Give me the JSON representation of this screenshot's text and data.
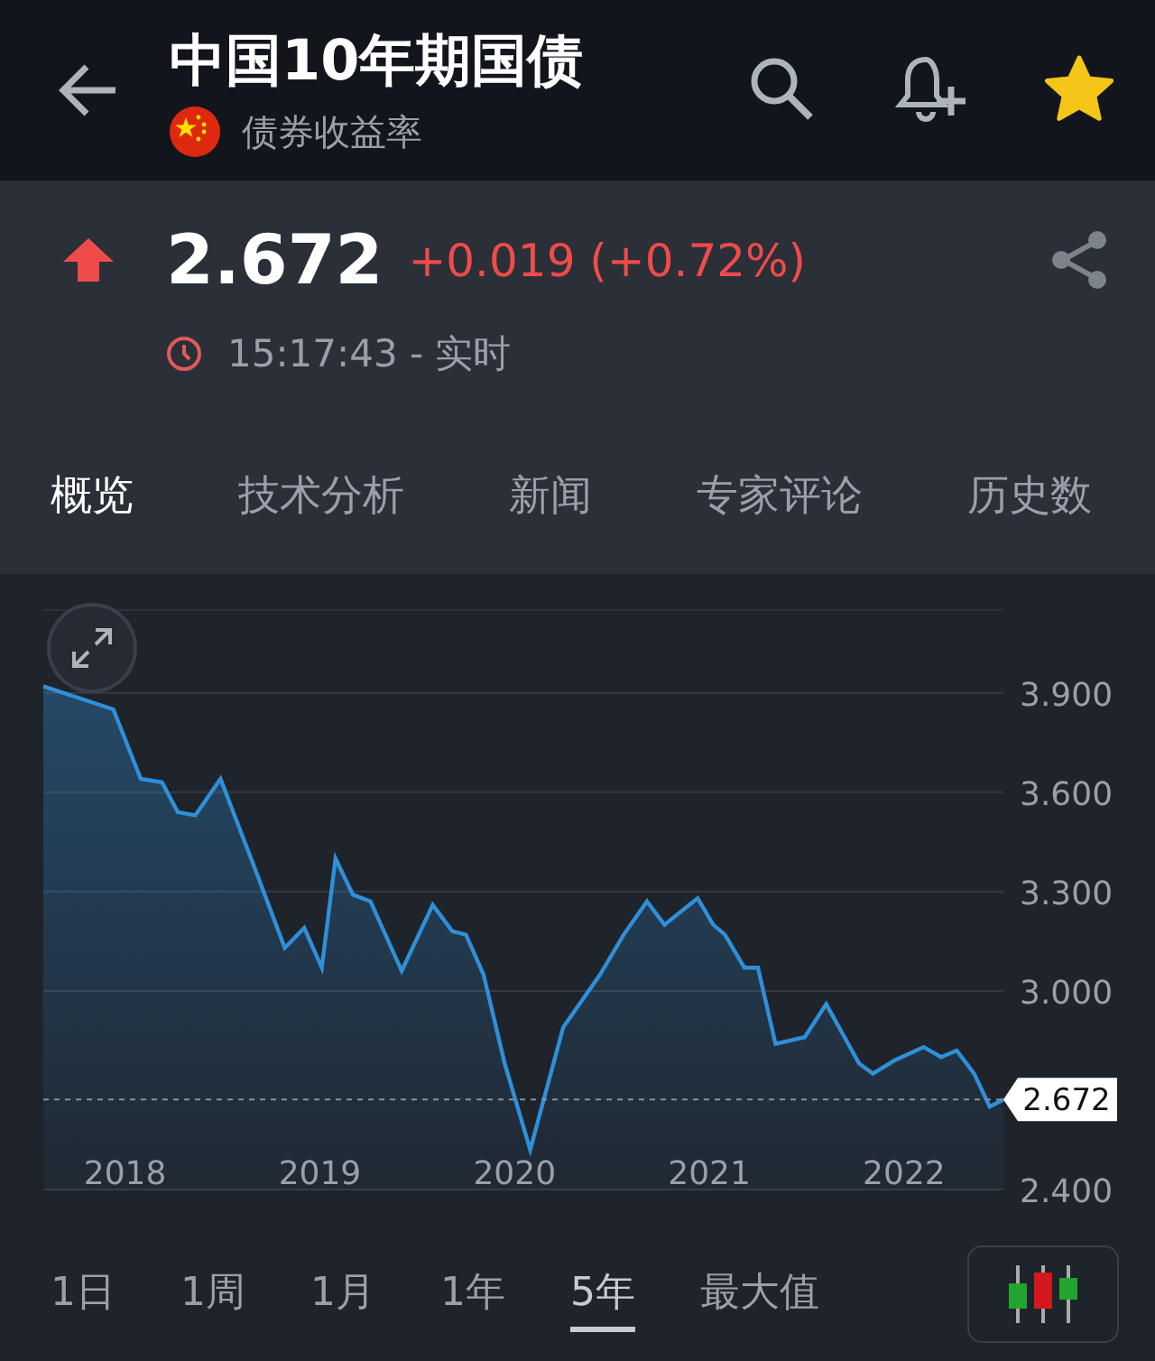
{
  "header": {
    "title": "中国10年期国债",
    "subtitle": "债券收益率",
    "favorite": true
  },
  "quote": {
    "price": "2.672",
    "rising": true,
    "change": "+0.019 (+0.72%)",
    "time": "15:17:43 - 实时"
  },
  "tabs": [
    {
      "label": "概览",
      "selected": true
    },
    {
      "label": "技术分析",
      "selected": false
    },
    {
      "label": "新闻",
      "selected": false
    },
    {
      "label": "专家评论",
      "selected": false
    },
    {
      "label": "历史数",
      "selected": false
    }
  ],
  "chart": {
    "chart_data": {
      "type": "area",
      "grid": true,
      "ref_lines": [
        {
          "value": 2.672,
          "axis": "y",
          "color": "#8a9098",
          "label": "2.672"
        }
      ],
      "x": [
        2017.58,
        2017.94,
        2018.08,
        2018.19,
        2018.27,
        2018.36,
        2018.49,
        2018.66,
        2018.82,
        2018.92,
        2019.01,
        2019.08,
        2019.17,
        2019.26,
        2019.42,
        2019.58,
        2019.68,
        2019.75,
        2019.84,
        2019.95,
        2020.08,
        2020.25,
        2020.44,
        2020.56,
        2020.68,
        2020.77,
        2020.94,
        2021.02,
        2021.08,
        2021.18,
        2021.25,
        2021.34,
        2021.49,
        2021.6,
        2021.77,
        2021.84,
        2021.95,
        2022.1,
        2022.19,
        2022.27,
        2022.36,
        2022.44,
        2022.51
      ],
      "series": [
        {
          "color": "#2f8fd8",
          "values": [
            3.92,
            3.85,
            3.64,
            3.63,
            3.54,
            3.53,
            3.64,
            3.38,
            3.13,
            3.19,
            3.07,
            3.4,
            3.29,
            3.27,
            3.06,
            3.26,
            3.18,
            3.17,
            3.05,
            2.78,
            2.52,
            2.89,
            3.05,
            3.17,
            3.27,
            3.2,
            3.28,
            3.2,
            3.17,
            3.07,
            3.07,
            2.84,
            2.86,
            2.96,
            2.78,
            2.75,
            2.79,
            2.83,
            2.8,
            2.82,
            2.75,
            2.65,
            2.672
          ]
        }
      ],
      "xlim": [
        2017.58,
        2022.51
      ],
      "ylim": [
        2.4,
        4.15
      ],
      "xticks": [
        {
          "value": 2018,
          "label": "2018"
        },
        {
          "value": 2019,
          "label": "2019"
        },
        {
          "value": 2020,
          "label": "2020"
        },
        {
          "value": 2021,
          "label": "2021"
        },
        {
          "value": 2022,
          "label": "2022"
        }
      ],
      "yticks": [
        {
          "value": 2.4,
          "label": "2.400"
        },
        {
          "value": 3.0,
          "label": "3.000"
        },
        {
          "value": 3.3,
          "label": "3.300"
        },
        {
          "value": 3.6,
          "label": "3.600"
        },
        {
          "value": 3.9,
          "label": "3.900"
        }
      ]
    }
  },
  "ranges": [
    {
      "label": "1日",
      "selected": false
    },
    {
      "label": "1周",
      "selected": false
    },
    {
      "label": "1月",
      "selected": false
    },
    {
      "label": "1年",
      "selected": false
    },
    {
      "label": "5年",
      "selected": true
    },
    {
      "label": "最大值",
      "selected": false
    }
  ]
}
